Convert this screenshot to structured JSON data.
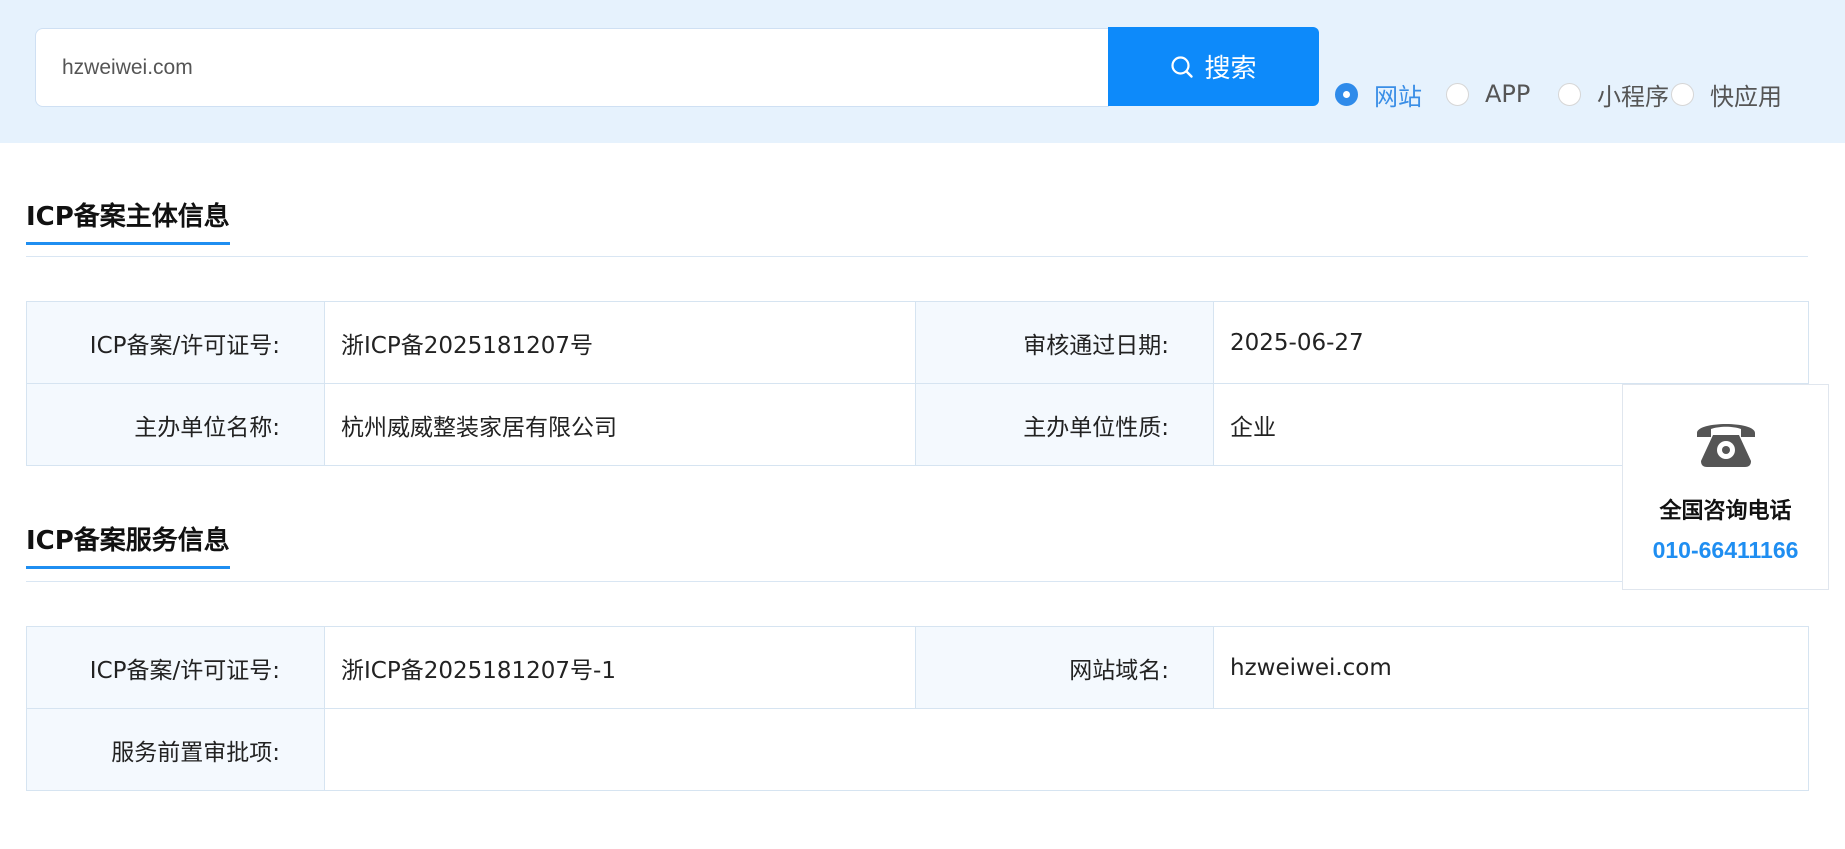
{
  "search": {
    "value": "hzweiwei.com",
    "button_label": "搜索"
  },
  "radio_options": [
    {
      "label": "网站",
      "checked": true
    },
    {
      "label": "APP",
      "checked": false
    },
    {
      "label": "小程序",
      "checked": false
    },
    {
      "label": "快应用",
      "checked": false
    }
  ],
  "section1": {
    "title": "ICP备案主体信息",
    "rows": [
      {
        "label1": "ICP备案/许可证号:",
        "value1": "浙ICP备2025181207号",
        "label2": "审核通过日期:",
        "value2": "2025-06-27"
      },
      {
        "label1": "主办单位名称:",
        "value1": "杭州威威整装家居有限公司",
        "label2": "主办单位性质:",
        "value2": "企业"
      }
    ]
  },
  "section2": {
    "title": "ICP备案服务信息",
    "rows": [
      {
        "label1": "ICP备案/许可证号:",
        "value1": "浙ICP备2025181207号-1",
        "label2": "网站域名:",
        "value2": "hzweiwei.com"
      }
    ],
    "approval_label": "服务前置审批项:",
    "approval_value": ""
  },
  "consult": {
    "icon": "telephone-icon",
    "title": "全国咨询电话",
    "number": "010-66411166"
  },
  "colors": {
    "accent": "#0d8afa",
    "top_bar_bg": "#e6f2fd",
    "label_cell_bg": "#f4f9fe"
  }
}
